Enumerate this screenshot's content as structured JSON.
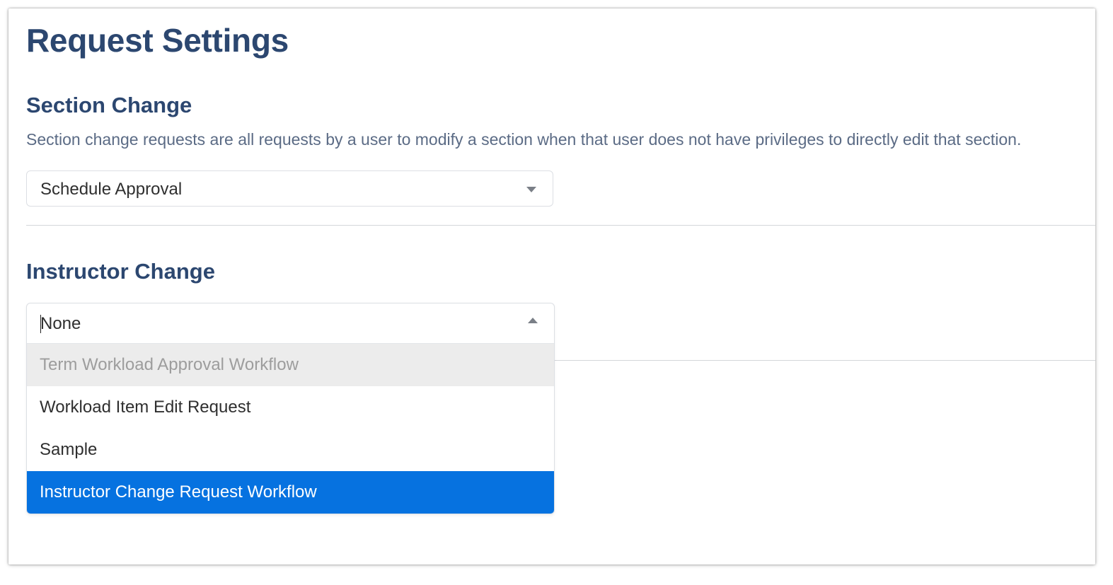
{
  "page": {
    "title": "Request Settings"
  },
  "section_change": {
    "heading": "Section Change",
    "description": "Section change requests are all requests by a user to modify a section when that user does not have privileges to directly edit that section.",
    "select": {
      "value": "Schedule Approval",
      "icon": "chevron-down-icon"
    }
  },
  "instructor_change": {
    "heading": "Instructor Change",
    "select": {
      "value": "None",
      "icon": "chevron-up-icon",
      "open": true,
      "options": [
        {
          "label": "Term Workload Approval Workflow",
          "disabled": true
        },
        {
          "label": "Workload Item Edit Request"
        },
        {
          "label": "Sample"
        },
        {
          "label": "Instructor Change Request Workflow",
          "highlighted": true
        }
      ]
    }
  },
  "colors": {
    "heading": "#2c4770",
    "description": "#5b6b85",
    "option_highlight": "#0672e0",
    "option_disabled_bg": "#ececec"
  }
}
